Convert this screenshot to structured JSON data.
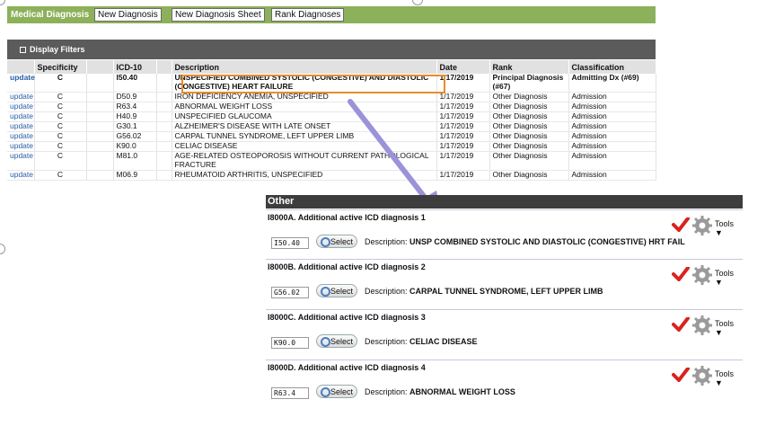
{
  "header": {
    "title": "Medical Diagnosis",
    "buttons": [
      "New Diagnosis",
      "New Diagnosis Sheet",
      "Rank Diagnoses"
    ],
    "color": "#8cb15a"
  },
  "filters": {
    "label": "Display Filters"
  },
  "table": {
    "columns": [
      "",
      "Specificity",
      "",
      "ICD-10",
      "",
      "Description",
      "Date",
      "Rank",
      "Classification"
    ],
    "rows": [
      {
        "action": "update",
        "spec": "C",
        "icd": "I50.40",
        "desc": "UNSPECIFIED COMBINED SYSTOLIC (CONGESTIVE) AND DIASTOLIC (CONGESTIVE) HEART FAILURE",
        "date": "1/17/2019",
        "rank": "Principal Diagnosis (#67)",
        "cls": "Admitting Dx (#69)"
      },
      {
        "action": "update",
        "spec": "C",
        "icd": "D50.9",
        "desc": "IRON DEFICIENCY ANEMIA, UNSPECIFIED",
        "date": "1/17/2019",
        "rank": "Other Diagnosis",
        "cls": "Admission"
      },
      {
        "action": "update",
        "spec": "C",
        "icd": "R63.4",
        "desc": "ABNORMAL WEIGHT LOSS",
        "date": "1/17/2019",
        "rank": "Other Diagnosis",
        "cls": "Admission"
      },
      {
        "action": "update",
        "spec": "C",
        "icd": "H40.9",
        "desc": "UNSPECIFIED GLAUCOMA",
        "date": "1/17/2019",
        "rank": "Other Diagnosis",
        "cls": "Admission"
      },
      {
        "action": "update",
        "spec": "C",
        "icd": "G30.1",
        "desc": "ALZHEIMER'S DISEASE WITH LATE ONSET",
        "date": "1/17/2019",
        "rank": "Other Diagnosis",
        "cls": "Admission"
      },
      {
        "action": "update",
        "spec": "C",
        "icd": "G56.02",
        "desc": "CARPAL TUNNEL SYNDROME, LEFT UPPER LIMB",
        "date": "1/17/2019",
        "rank": "Other Diagnosis",
        "cls": "Admission"
      },
      {
        "action": "update",
        "spec": "C",
        "icd": "K90.0",
        "desc": "CELIAC DISEASE",
        "date": "1/17/2019",
        "rank": "Other Diagnosis",
        "cls": "Admission"
      },
      {
        "action": "update",
        "spec": "C",
        "icd": "M81.0",
        "desc": "AGE-RELATED OSTEOPOROSIS WITHOUT CURRENT PATHOLOGICAL FRACTURE",
        "date": "1/17/2019",
        "rank": "Other Diagnosis",
        "cls": "Admission"
      },
      {
        "action": "update",
        "spec": "C",
        "icd": "M06.9",
        "desc": "RHEUMATOID ARTHRITIS, UNSPECIFIED",
        "date": "1/17/2019",
        "rank": "Other Diagnosis",
        "cls": "Admission"
      }
    ]
  },
  "panel": {
    "title": "Other",
    "select_label": "Select",
    "desc_prefix": "Description:",
    "tools_label": "Tools ▼",
    "items": [
      {
        "title": "I8000A.  Additional active ICD diagnosis 1",
        "code": "I50.40",
        "desc": "UNSP COMBINED SYSTOLIC AND DIASTOLIC (CONGESTIVE) HRT FAIL"
      },
      {
        "title": "I8000B.  Additional active ICD diagnosis 2",
        "code": "G56.02",
        "desc": "CARPAL TUNNEL SYNDROME, LEFT UPPER LIMB"
      },
      {
        "title": "I8000C.  Additional active ICD diagnosis 3",
        "code": "K90.0",
        "desc": "CELIAC DISEASE"
      },
      {
        "title": "I8000D.  Additional active ICD diagnosis 4",
        "code": "R63.4",
        "desc": "ABNORMAL WEIGHT LOSS"
      }
    ]
  },
  "colors": {
    "highlight": "#e98c2a",
    "arrow": "#9a93d8",
    "check": "#d9231f",
    "link": "#2b5ea8"
  }
}
